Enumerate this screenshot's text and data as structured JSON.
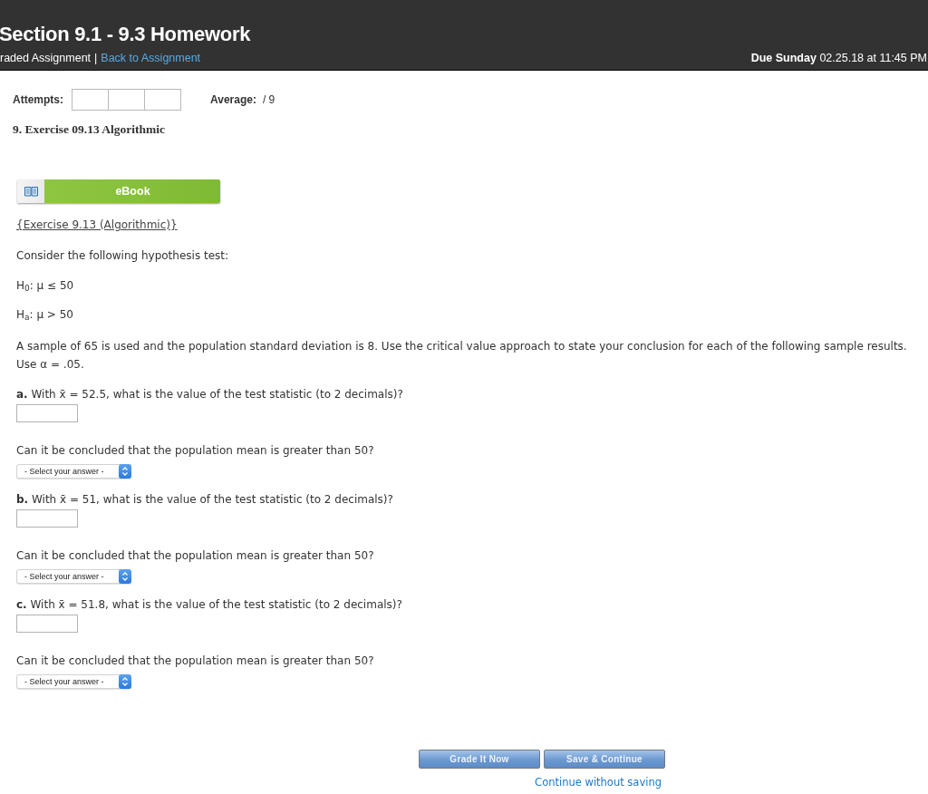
{
  "header": {
    "title": "Section 9.1 - 9.3 Homework",
    "assignment_type": "raded Assignment",
    "separator": "|",
    "back_link": "Back to Assignment",
    "due": "**Due Sunday** 02.25.18 at 11:45 PM"
  },
  "attempts": {
    "label": "Attempts:",
    "slots": [
      {
        "used": false
      },
      {
        "used": false
      },
      {
        "used": false
      }
    ]
  },
  "average": {
    "label": "Average:",
    "value": "/ 9"
  },
  "exercise": {
    "title": "9. Exercise 09.13 Algorithmic",
    "ebook_button": "eBook",
    "reference_link": "{Exercise 9.13 (Algorithmic)}",
    "intro": "Consider the following hypothesis test:",
    "hypotheses": [
      "H$_{0}$: μ ≤ 50",
      "H$_{a}$: μ > 50"
    ],
    "paragraph": [
      "A sample of 65 is used and the population standard deviation is 8. Use the critical value approach to state your conclusion for each of the following sample results.",
      "Use α = .05."
    ]
  },
  "parts": [
    {
      "question": "**a.** With x̄ = 52.5, what is the value of the test statistic (to 2 decimals)?",
      "follow_up": "Can it be concluded that the population mean is greater than 50?",
      "select": {
        "value": "- Select your answer -"
      }
    },
    {
      "question": "**b.** With x̄ = 51, what is the value of the test statistic (to 2 decimals)?",
      "follow_up": "Can it be concluded that the population mean is greater than 50?",
      "select": {
        "value": "- Select your answer -"
      }
    },
    {
      "question": "**c.** With x̄ = 51.8, what is the value of the test statistic (to 2 decimals)?",
      "follow_up": "Can it be concluded that the population mean is greater than 50?",
      "select": {
        "value": "- Select your answer -"
      }
    }
  ],
  "actions": {
    "buttons": [
      "Grade It Now",
      "Save & Continue"
    ],
    "link": "Continue without saving"
  }
}
